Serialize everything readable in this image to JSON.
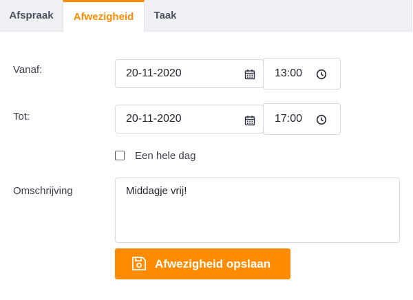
{
  "tabs": [
    {
      "label": "Afspraak"
    },
    {
      "label": "Afwezigheid",
      "active": true
    },
    {
      "label": "Taak"
    }
  ],
  "form": {
    "from_label": "Vanaf:",
    "from_date": "20-11-2020",
    "from_time": "13:00",
    "to_label": "Tot:",
    "to_date": "20-11-2020",
    "to_time": "17:00",
    "allday_label": "Een hele dag",
    "allday_checked": false,
    "description_label": "Omschrijving",
    "description_value": "Middagje vrij!",
    "save_label": "Afwezigheid opslaan"
  },
  "colors": {
    "accent": "#ff8c00",
    "tab_bg": "#eef0f3",
    "border": "#d5dae1"
  },
  "icons": {
    "date": "calendar-icon",
    "time": "clock-icon",
    "save": "floppy-disk-icon"
  }
}
